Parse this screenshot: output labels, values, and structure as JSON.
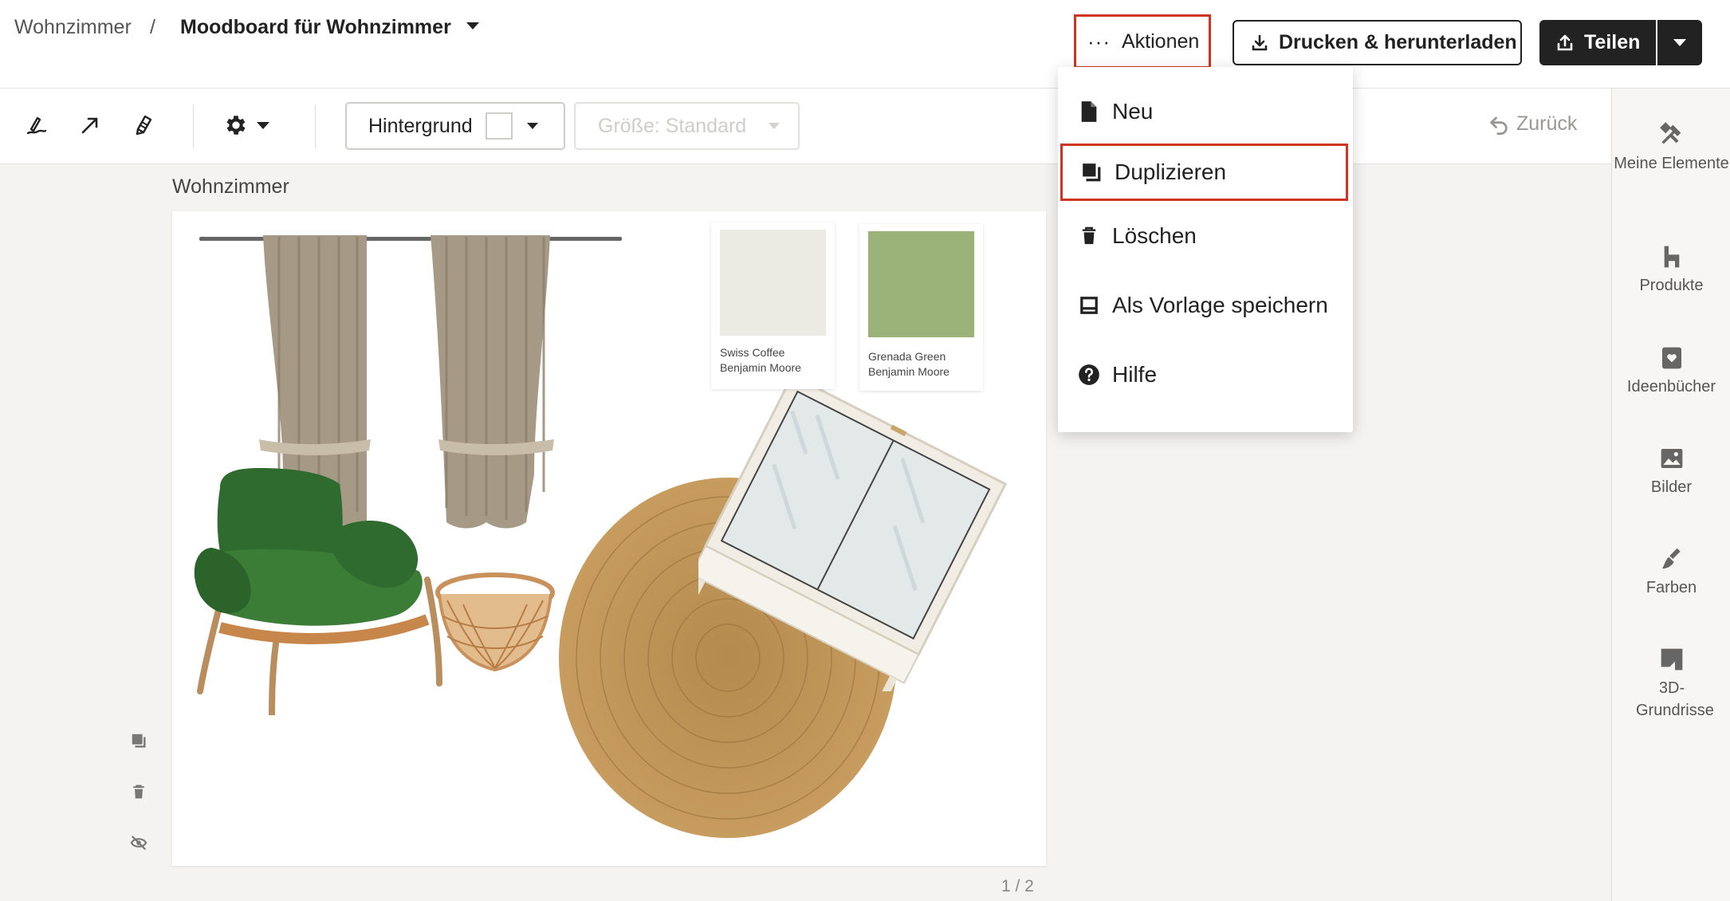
{
  "breadcrumb": {
    "root": "Wohnzimmer",
    "separator": "/",
    "title": "Moodboard für Wohnzimmer"
  },
  "header": {
    "actions_label": "Aktionen",
    "print_label": "Drucken & herunterladen",
    "share_label": "Teilen"
  },
  "toolbar": {
    "background_label": "Hintergrund",
    "size_label": "Größe: Standard",
    "undo_label": "Zurück"
  },
  "menu": {
    "items": [
      {
        "label": "Neu",
        "icon": "file-icon"
      },
      {
        "label": "Duplizieren",
        "icon": "duplicate-icon",
        "highlighted": true
      },
      {
        "label": "Löschen",
        "icon": "trash-icon"
      },
      {
        "label": "Als Vorlage speichern",
        "icon": "template-icon"
      },
      {
        "label": "Hilfe",
        "icon": "help-icon"
      }
    ]
  },
  "sidebar": {
    "items": [
      {
        "label": "Meine Elemente",
        "icon": "my-elements-icon"
      },
      {
        "label": "Produkte",
        "icon": "products-icon"
      },
      {
        "label": "Ideenbücher",
        "icon": "ideabooks-icon"
      },
      {
        "label": "Bilder",
        "icon": "images-icon"
      },
      {
        "label": "Farben",
        "icon": "brush-icon"
      },
      {
        "label": "3D-Grundrisse",
        "icon": "floorplan-icon"
      }
    ]
  },
  "board": {
    "title": "Wohnzimmer",
    "page_indicator": "1 / 2",
    "paint_chips": [
      {
        "name": "Swiss Coffee",
        "brand": "Benjamin Moore",
        "color": "#ecebe3"
      },
      {
        "name": "Grenada Green",
        "brand": "Benjamin Moore",
        "color": "#9bb379"
      }
    ]
  },
  "colors": {
    "accent_red": "#d0351f",
    "dark": "#222222"
  }
}
